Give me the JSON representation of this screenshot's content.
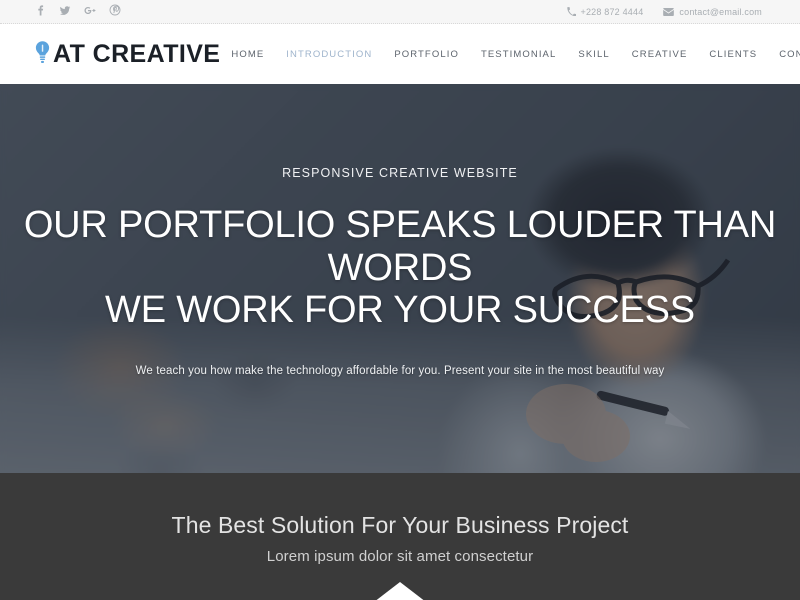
{
  "topbar": {
    "social": [
      {
        "name": "facebook-icon",
        "label": "Facebook"
      },
      {
        "name": "twitter-icon",
        "label": "Twitter"
      },
      {
        "name": "google-plus-icon",
        "label": "Google Plus"
      },
      {
        "name": "pinterest-icon",
        "label": "Pinterest"
      }
    ],
    "phone": "+228 872 4444",
    "email": "contact@email.com"
  },
  "header": {
    "logo_text": "AT CREATIVE",
    "logo_icon": "lightbulb-icon",
    "logo_icon_color": "#5ba3dd",
    "menu_toggle_icon": "hamburger-icon",
    "nav": [
      {
        "label": "HOME",
        "active": false
      },
      {
        "label": "INTRODUCTION",
        "active": true
      },
      {
        "label": "PORTFOLIO",
        "active": false
      },
      {
        "label": "TESTIMONIAL",
        "active": false
      },
      {
        "label": "SKILL",
        "active": false
      },
      {
        "label": "CREATIVE",
        "active": false
      },
      {
        "label": "CLIENTS",
        "active": false
      },
      {
        "label": "CONTACT",
        "active": false
      }
    ],
    "nav_active_color": "#9fb4cc"
  },
  "hero": {
    "kicker": "RESPONSIVE CREATIVE WEBSITE",
    "title_line1": "OUR PORTFOLIO SPEAKS LOUDER THAN WORDS",
    "title_line2": "WE WORK FOR YOUR SUCCESS",
    "subtitle": "We teach you how make the technology affordable for you. Present your site in the most beautiful way"
  },
  "band": {
    "title": "The Best Solution For Your Business Project",
    "subtitle": "Lorem ipsum dolor sit amet consectetur",
    "arrow_icon": "chevron-up-icon",
    "background_color": "#3a3a3a"
  }
}
